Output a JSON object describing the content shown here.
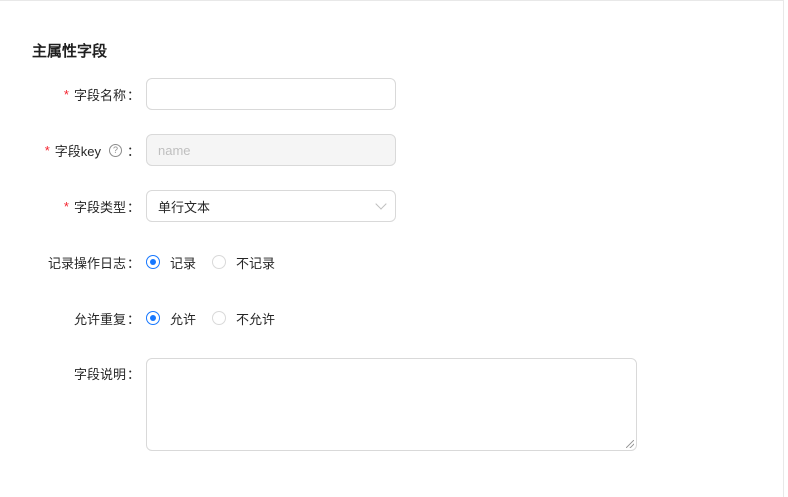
{
  "section": {
    "title": "主属性字段"
  },
  "fields": {
    "name": {
      "label": "字段名称",
      "value": ""
    },
    "key": {
      "label": "字段key",
      "placeholder": "name"
    },
    "type": {
      "label": "字段类型",
      "value": "单行文本"
    },
    "log": {
      "label": "记录操作日志",
      "options": [
        "记录",
        "不记录"
      ],
      "selected": "记录"
    },
    "repeat": {
      "label": "允许重复",
      "options": [
        "允许",
        "不允许"
      ],
      "selected": "允许"
    },
    "desc": {
      "label": "字段说明",
      "value": ""
    }
  },
  "required_mark": "*",
  "colon": "：",
  "colors": {
    "primary": "#1677ff",
    "required": "#f5222d",
    "border": "#d9d9d9"
  }
}
